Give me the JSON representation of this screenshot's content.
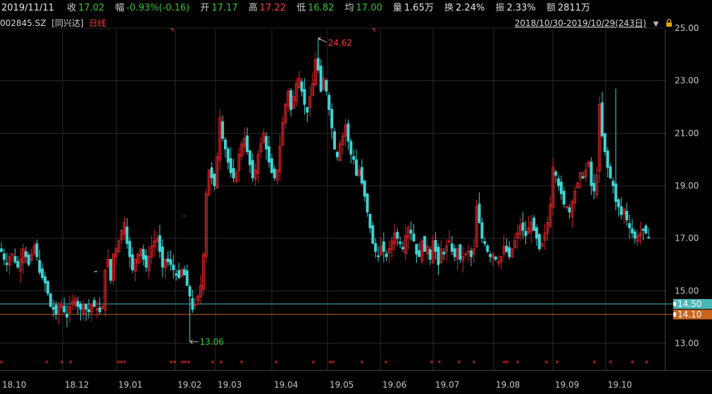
{
  "header": {
    "date": "2019/11/11",
    "close_label": "收",
    "close_value": "17.02",
    "change_label": "幅",
    "change_value": "-0.93%(-0.16)",
    "open_label": "开",
    "open_value": "17.17",
    "high_label": "高",
    "high_value": "17.22",
    "low_label": "低",
    "low_value": "16.82",
    "avg_label": "均",
    "avg_value": "17.00",
    "volume_label": "量",
    "volume_value": "1.65万",
    "turnover_label": "换",
    "turnover_value": "2.24%",
    "amplitude_label": "振",
    "amplitude_value": "2.33%",
    "amount_label": "额",
    "amount_value": "2811万"
  },
  "subheader": {
    "code": "002845.SZ",
    "name": "[同兴达]",
    "period": "日线",
    "range": "2018/10/30-2019/10/29(243日)"
  },
  "colors": {
    "up": "#d9232b",
    "down": "#3fd2d2",
    "grid": "#2a2a2a",
    "axis_text": "#c8c8c8",
    "line_cyan": "#4ab7b7",
    "line_orange": "#c8651e",
    "star": "#ff3030"
  },
  "chart_data": {
    "type": "candlestick",
    "y_ticks": [
      "25.00",
      "23.00",
      "21.00",
      "19.00",
      "17.00",
      "15.00",
      "13.00"
    ],
    "x_labels": [
      "18.10",
      "18.12",
      "19.01",
      "19.02",
      "19.03",
      "19.04",
      "19.05",
      "19.06",
      "19.07",
      "19.08",
      "19.09",
      "19.10"
    ],
    "ylim": [
      12.2,
      25.1
    ],
    "high_marker": "24.62",
    "low_marker": "13.06",
    "horizontal_lines": [
      {
        "value": 14.5,
        "label": "14.50",
        "color": "cyan"
      },
      {
        "value": 14.1,
        "label": "14.10",
        "color": "orange"
      }
    ],
    "closes": [
      16.5,
      16.2,
      16.0,
      16.3,
      16.4,
      16.1,
      15.9,
      16.2,
      16.6,
      16.3,
      16.0,
      16.4,
      16.7,
      16.3,
      15.7,
      15.5,
      15.3,
      14.9,
      14.4,
      14.3,
      14.1,
      14.4,
      14.5,
      14.2,
      14.0,
      14.4,
      14.6,
      14.7,
      14.4,
      14.3,
      14.5,
      14.3,
      14.2,
      14.5,
      14.4,
      14.3,
      14.2,
      14.4,
      15.8,
      16.2,
      15.4,
      16.4,
      16.6,
      16.9,
      17.3,
      17.6,
      16.8,
      16.3,
      15.8,
      16.2,
      16.4,
      16.6,
      16.2,
      15.9,
      16.3,
      16.7,
      16.9,
      17.0,
      16.5,
      15.9,
      16.2,
      16.1,
      16.0,
      15.8,
      15.6,
      15.5,
      15.8,
      15.6,
      15.2,
      14.8,
      14.3,
      14.5,
      14.8,
      15.2,
      16.4,
      18.7,
      19.6,
      19.3,
      19.0,
      20.1,
      21.6,
      20.8,
      20.4,
      19.9,
      19.5,
      19.3,
      19.5,
      20.2,
      20.6,
      20.8,
      20.3,
      19.8,
      19.3,
      19.6,
      20.2,
      20.6,
      21.0,
      20.4,
      19.9,
      19.5,
      19.3,
      19.6,
      20.5,
      21.4,
      22.1,
      22.6,
      21.9,
      22.4,
      22.9,
      23.1,
      22.6,
      22.1,
      21.8,
      22.4,
      22.9,
      23.8,
      23.4,
      22.6,
      23.1,
      22.6,
      21.9,
      21.2,
      20.4,
      20.1,
      20.6,
      20.9,
      21.3,
      20.7,
      20.2,
      20.0,
      19.4,
      19.6,
      19.1,
      18.6,
      18.0,
      17.4,
      16.8,
      16.5,
      16.3,
      16.7,
      16.5,
      16.3,
      16.6,
      16.9,
      17.2,
      17.0,
      16.8,
      16.6,
      17.1,
      17.4,
      17.2,
      16.9,
      16.4,
      16.3,
      16.9,
      16.5,
      16.7,
      16.2,
      16.9,
      16.5,
      16.0,
      16.6,
      16.4,
      16.7,
      16.9,
      16.5,
      16.3,
      16.6,
      16.2,
      16.3,
      16.4,
      16.5,
      16.3,
      16.6,
      18.2,
      17.6,
      17.0,
      16.8,
      16.5,
      16.3,
      16.4,
      16.2,
      16.1,
      16.3,
      16.7,
      16.5,
      16.3,
      16.6,
      16.9,
      17.2,
      17.5,
      17.3,
      17.1,
      17.4,
      17.6,
      17.3,
      17.0,
      16.6,
      16.8,
      17.2,
      17.6,
      18.3,
      19.7,
      19.4,
      19.0,
      18.7,
      18.3,
      18.2,
      18.0,
      18.4,
      18.8,
      19.1,
      19.5,
      19.3,
      19.6,
      19.9,
      19.0,
      18.8,
      19.4,
      22.1,
      20.9,
      20.3,
      19.7,
      19.3,
      19.0,
      18.4,
      18.2,
      17.9,
      18.1,
      17.7,
      17.4,
      17.2,
      17.0,
      17.1,
      17.2,
      17.3,
      17.2,
      17.02
    ]
  },
  "star_labels": {
    "symbol": "*"
  }
}
